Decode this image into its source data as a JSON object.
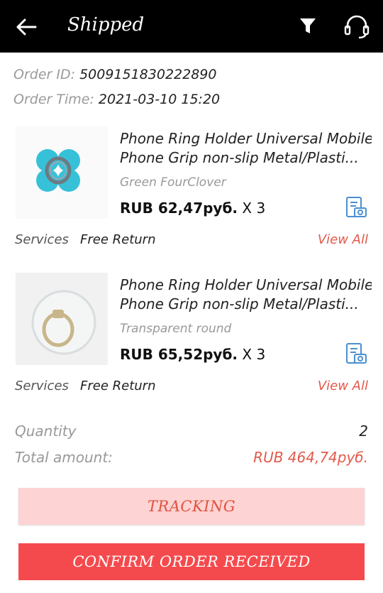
{
  "header": {
    "title": "Shipped"
  },
  "order": {
    "id_label": "Order ID:",
    "id_value": "5009151830222890",
    "time_label": "Order Time:",
    "time_value": "2021-03-10 15:20"
  },
  "products": [
    {
      "name_line1": "Phone Ring Holder Universal Mobile",
      "name_line2": "Phone Grip non-slip Metal/Plasti...",
      "variant": "Green FourClover",
      "price": "RUB 62,47руб.",
      "qty": " X 3",
      "services_label": "Services",
      "services_value": "Free Return",
      "view_all": "View All",
      "thumb_icon": "clover-ring-holder"
    },
    {
      "name_line1": "Phone Ring Holder Universal Mobile",
      "name_line2": "Phone Grip non-slip Metal/Plasti...",
      "variant": "Transparent round",
      "price": "RUB 65,52руб.",
      "qty": " X 3",
      "services_label": "Services",
      "services_value": "Free Return",
      "view_all": "View All",
      "thumb_icon": "transparent-ring-holder"
    }
  ],
  "summary": {
    "quantity_label": "Quantity",
    "quantity_value": "2",
    "total_label": "Total amount:",
    "total_value": "RUB 464,74руб."
  },
  "buttons": {
    "tracking": "TRACKING",
    "confirm": "CONFIRM ORDER RECEIVED"
  },
  "colors": {
    "accent": "#e35a4c",
    "confirm_bg": "#f54a4d",
    "tracking_bg": "#fdd3d3",
    "invoice_icon": "#4a8fd0"
  }
}
